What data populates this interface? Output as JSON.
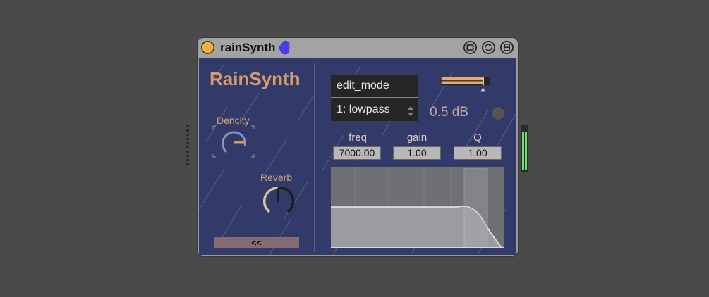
{
  "window": {
    "title": "rainSynth"
  },
  "panel": {
    "app_title": "RainSynth",
    "knobs": [
      {
        "label": "Dencity"
      },
      {
        "label": "Reverb"
      }
    ],
    "collapse_label": "<<"
  },
  "filter": {
    "edit_mode_label": "edit_mode",
    "type_value": "1: lowpass",
    "gain_display": "0.5 dB",
    "params": [
      {
        "label": "freq",
        "value": "7000.00"
      },
      {
        "label": "gain",
        "value": "1.00"
      },
      {
        "label": "Q",
        "value": "1.00"
      }
    ]
  },
  "colors": {
    "background": "#4a4a4a",
    "panel": "#323a6a",
    "accent": "#d89b6b",
    "power": "#f2b13a",
    "meter": "#6fdc6f"
  }
}
